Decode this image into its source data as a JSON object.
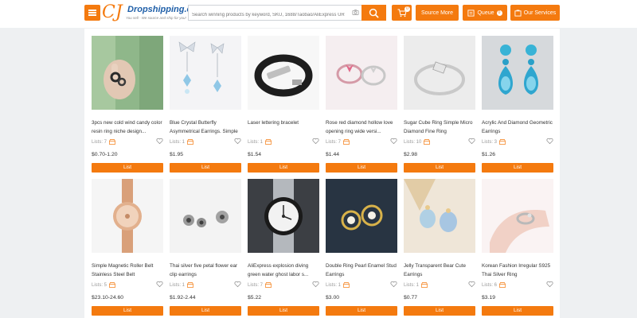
{
  "header": {
    "logo_brand": "Dropshipping.com",
    "logo_tagline": "You sell - We source and ship for you!",
    "search_placeholder": "Search winning products by keyword, SKU, 1688/Taobao/AliExpress URL",
    "cart_count": "0",
    "source_more_label": "Source More",
    "queue_label": "Queue",
    "queue_count": "0",
    "services_label": "Our Services"
  },
  "accent_color": "#f47a0f",
  "products": [
    {
      "title": "3pcs new cold wind candy color resin ring niche design...",
      "lists": "Lists: 7",
      "price": "$0.70-1.20",
      "button": "List",
      "image": "green-sweater-hand-rings"
    },
    {
      "title": "Blue Crystal Butterfly Asymmetrical Earrings. Simple ...",
      "lists": "Lists: 1",
      "price": "$1.95",
      "button": "List",
      "image": "butterfly-earrings"
    },
    {
      "title": "Laser lettering bracelet",
      "lists": "Lists: 1",
      "price": "$1.54",
      "button": "List",
      "image": "leather-bracelet"
    },
    {
      "title": "Rose red diamond hollow love opening ring wide versi...",
      "lists": "Lists: 7",
      "price": "$1.44",
      "button": "List",
      "image": "heart-rings"
    },
    {
      "title": "Sugar Cube Ring Simple Micro Diamond Fine Ring",
      "lists": "Lists: 10",
      "price": "$2.98",
      "button": "List",
      "image": "silver-ring"
    },
    {
      "title": "Acrylic And Diamond Geometric Earrings",
      "lists": "Lists: 3",
      "price": "$1.26",
      "button": "List",
      "image": "blue-drop-earrings"
    },
    {
      "title": "Simple Magnetic Roller Belt Stainless Steel Belt",
      "lists": "Lists: 5",
      "price": "$23.10-24.60",
      "button": "List",
      "image": "rose-gold-watch"
    },
    {
      "title": "Thai silver five petal flower ear clip earrings",
      "lists": "Lists: 1",
      "price": "$1.92-2.44",
      "button": "List",
      "image": "flower-ear-clips"
    },
    {
      "title": "AliExpress explosion diving green water ghost labor s...",
      "lists": "Lists: 7",
      "price": "$5.22",
      "button": "List",
      "image": "steel-dive-watch"
    },
    {
      "title": "Double Ring Pearl Enamel Stud Earrings",
      "lists": "Lists: 1",
      "price": "$3.00",
      "button": "List",
      "image": "pearl-stud-earrings"
    },
    {
      "title": "Jelly Transparent Bear Cute Earrings",
      "lists": "Lists: 1",
      "price": "$0.77",
      "button": "List",
      "image": "bear-earrings"
    },
    {
      "title": "Korean Fashion Irregular S925 Thai Silver Ring",
      "lists": "Lists: 6",
      "price": "$3.19",
      "button": "List",
      "image": "silver-ring-hand"
    }
  ]
}
